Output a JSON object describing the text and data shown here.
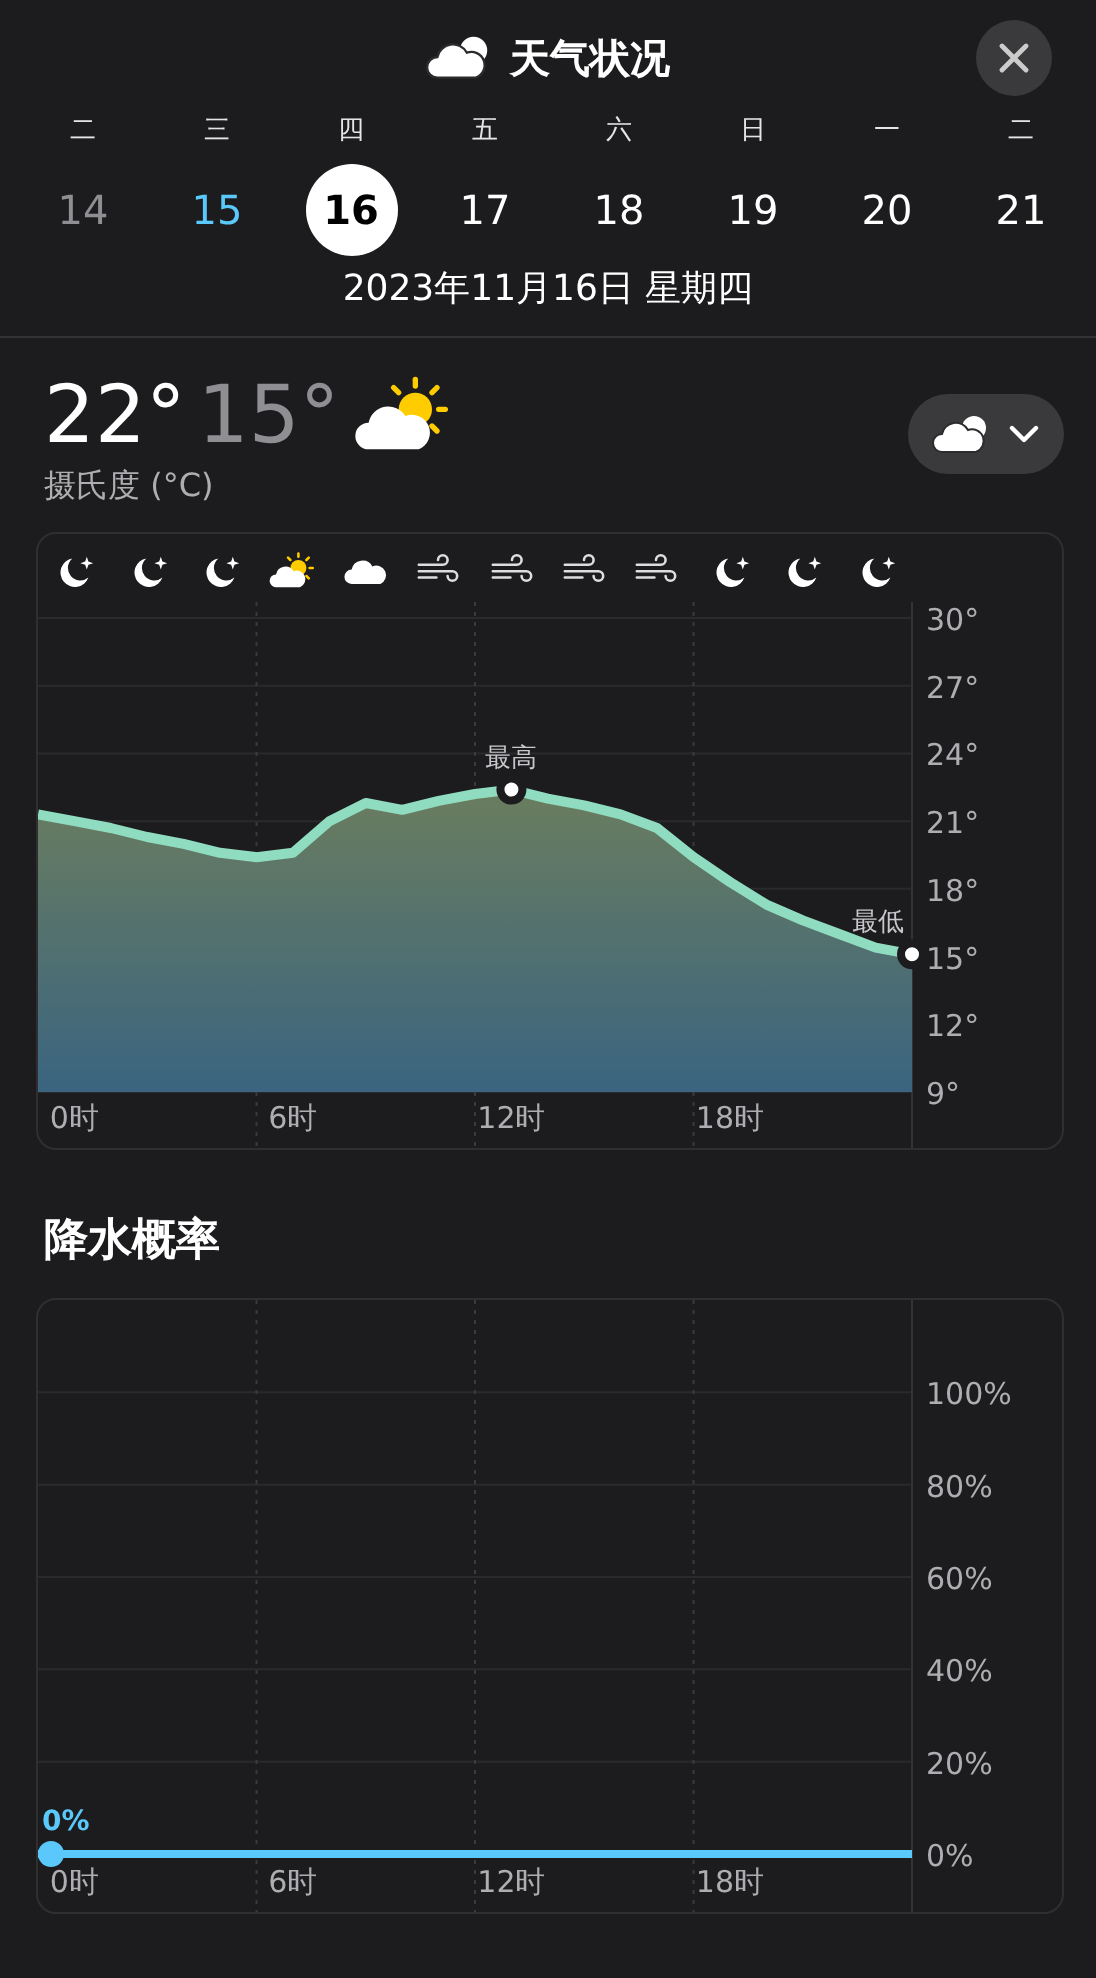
{
  "header": {
    "title": "天气状况"
  },
  "days": [
    {
      "weekday": "二",
      "date": "14",
      "kind": "past",
      "selected": false
    },
    {
      "weekday": "三",
      "date": "15",
      "kind": "today",
      "selected": false
    },
    {
      "weekday": "四",
      "date": "16",
      "kind": "future",
      "selected": true
    },
    {
      "weekday": "五",
      "date": "17",
      "kind": "future",
      "selected": false
    },
    {
      "weekday": "六",
      "date": "18",
      "kind": "future",
      "selected": false
    },
    {
      "weekday": "日",
      "date": "19",
      "kind": "future",
      "selected": false
    },
    {
      "weekday": "一",
      "date": "20",
      "kind": "future",
      "selected": false
    },
    {
      "weekday": "二",
      "date": "21",
      "kind": "future",
      "selected": false
    }
  ],
  "full_date": "2023年11月16日 星期四",
  "summary": {
    "high": "22°",
    "low": "15°",
    "unit": "摄氏度 (°C)"
  },
  "hourly_icons": [
    {
      "kind": "moon"
    },
    {
      "kind": "moon"
    },
    {
      "kind": "moon"
    },
    {
      "kind": "sun-cloud"
    },
    {
      "kind": "cloud"
    },
    {
      "kind": "wind"
    },
    {
      "kind": "wind"
    },
    {
      "kind": "wind"
    },
    {
      "kind": "wind"
    },
    {
      "kind": "moon"
    },
    {
      "kind": "moon"
    },
    {
      "kind": "moon"
    }
  ],
  "temperature": {
    "chart_data": {
      "type": "area",
      "x": [
        -1,
        0,
        1,
        2,
        3,
        4,
        5,
        6,
        7,
        8,
        9,
        10,
        11,
        12,
        13,
        14,
        15,
        16,
        17,
        18,
        19,
        20,
        21,
        22,
        23
      ],
      "series": [
        {
          "color": "#8fdcc0",
          "values": [
            21.3,
            21.0,
            20.7,
            20.3,
            20.0,
            19.6,
            19.4,
            19.6,
            21.0,
            21.8,
            21.5,
            21.9,
            22.2,
            22.4,
            22.0,
            21.7,
            21.3,
            20.7,
            19.4,
            18.3,
            17.3,
            16.6,
            16.0,
            15.4,
            15.1
          ]
        }
      ],
      "xlim": [
        -1,
        23
      ],
      "ylim": [
        9,
        30
      ],
      "grid": true,
      "xticks": [
        {
          "value": 0,
          "label": "0时"
        },
        {
          "value": 6,
          "label": "6时"
        },
        {
          "value": 12,
          "label": "12时"
        },
        {
          "value": 18,
          "label": "18时"
        }
      ],
      "yticks": [
        {
          "value": 30,
          "label": "30°"
        },
        {
          "value": 27,
          "label": "27°"
        },
        {
          "value": 24,
          "label": "24°"
        },
        {
          "value": 21,
          "label": "21°"
        },
        {
          "value": 18,
          "label": "18°"
        },
        {
          "value": 15,
          "label": "15°"
        },
        {
          "value": 12,
          "label": "12°"
        },
        {
          "value": 9,
          "label": "9°"
        }
      ],
      "annotations": [
        {
          "x": 12,
          "y": 22.4,
          "text": "最高"
        },
        {
          "x": 23,
          "y": 15.1,
          "text": "最低"
        }
      ]
    }
  },
  "precipitation": {
    "title": "降水概率",
    "chart_data": {
      "type": "line",
      "x": [
        -1,
        23
      ],
      "series": [
        {
          "color": "#5ac8fa",
          "values": [
            0,
            0
          ]
        }
      ],
      "xlim": [
        -1,
        23
      ],
      "ylim": [
        0,
        120
      ],
      "grid": true,
      "xticks": [
        {
          "value": 0,
          "label": "0时"
        },
        {
          "value": 6,
          "label": "6时"
        },
        {
          "value": 12,
          "label": "12时"
        },
        {
          "value": 18,
          "label": "18时"
        }
      ],
      "yticks": [
        {
          "value": 100,
          "label": "100%"
        },
        {
          "value": 80,
          "label": "80%"
        },
        {
          "value": 60,
          "label": "60%"
        },
        {
          "value": 40,
          "label": "40%"
        },
        {
          "value": 20,
          "label": "20%"
        },
        {
          "value": 0,
          "label": "0%"
        }
      ],
      "annotations": [
        {
          "x": -1,
          "y": 0,
          "text": "0%"
        }
      ]
    }
  }
}
